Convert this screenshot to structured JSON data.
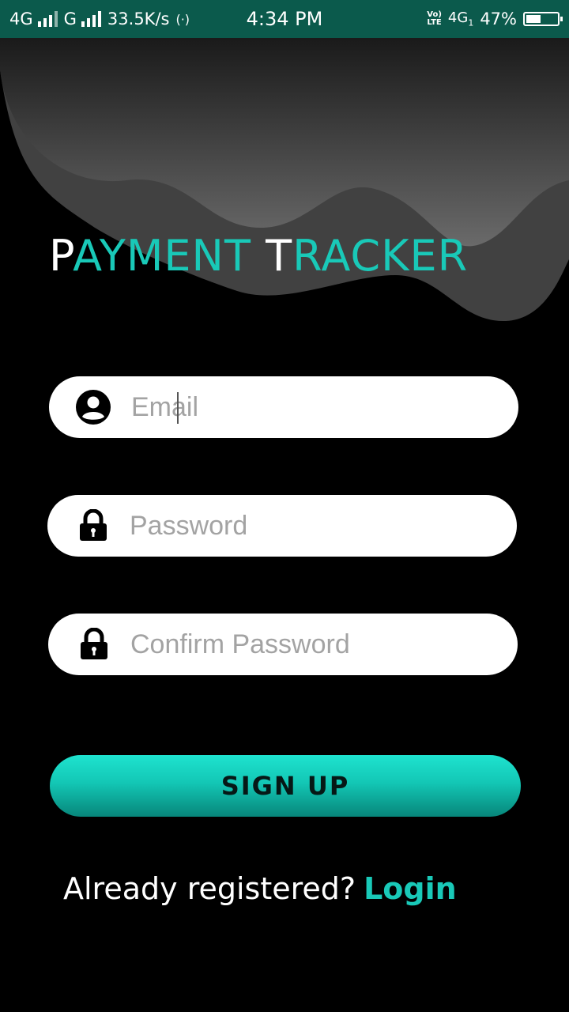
{
  "status_bar": {
    "sim1_network": "4G",
    "sim2_network": "G",
    "data_speed": "33.5K/s",
    "time": "4:34 PM",
    "volte_top": "Vo)",
    "volte_bottom": "LTE",
    "network_type": "4G",
    "network_sub": "1",
    "battery_percent": "47%",
    "battery_level": 0.47,
    "status_bar_color": "#0b5a4c"
  },
  "brand": {
    "word1_cap": "P",
    "word1_rest": "AYMENT",
    "word2_cap": "T",
    "word2_rest": "RACKER",
    "accent_color": "#19c9b8"
  },
  "form": {
    "email": {
      "placeholder": "Email",
      "value": "",
      "icon": "user-circle-icon"
    },
    "password": {
      "placeholder": "Password",
      "value": "",
      "icon": "lock-icon"
    },
    "confirm_password": {
      "placeholder": "Confirm Password",
      "value": "",
      "icon": "lock-icon"
    },
    "submit_label": "SIGN UP"
  },
  "footer": {
    "prompt": "Already registered?",
    "login_label": "Login"
  }
}
